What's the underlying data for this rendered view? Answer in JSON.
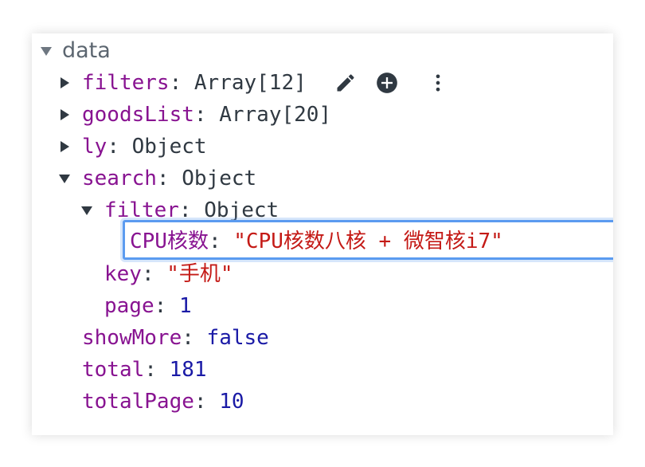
{
  "tree": {
    "root": {
      "label": "data"
    },
    "filters": {
      "key": "filters",
      "value": "Array[12]"
    },
    "goodsList": {
      "key": "goodsList",
      "value": "Array[20]"
    },
    "ly": {
      "key": "ly",
      "value": "Object"
    },
    "search": {
      "key": "search",
      "value": "Object",
      "filter": {
        "key": "filter",
        "value": "Object",
        "editing": {
          "key": "CPU核数",
          "value": "\"CPU核数八核 + 微智核i7\""
        }
      },
      "keyField": {
        "key": "key",
        "value": "\"手机\""
      },
      "page": {
        "key": "page",
        "value": "1"
      }
    },
    "showMore": {
      "key": "showMore",
      "value": "false"
    },
    "total": {
      "key": "total",
      "value": "181"
    },
    "totalPage": {
      "key": "totalPage",
      "value": "10"
    }
  },
  "colon": ":",
  "icons": {
    "edit": "pencil-icon",
    "add": "plus-circle-icon",
    "more": "more-vertical-icon"
  },
  "colors": {
    "key": "#881391",
    "string": "#c41a16",
    "number": "#1a1aa6",
    "focus": "#5b9bf0"
  }
}
